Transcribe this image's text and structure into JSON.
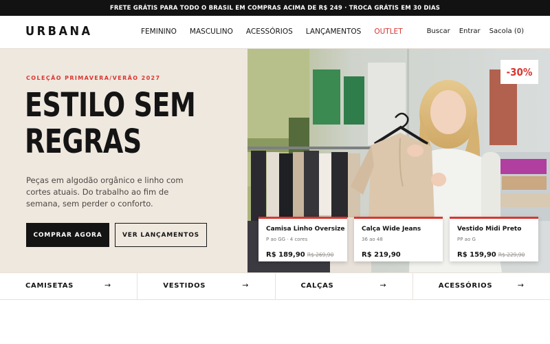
{
  "promo": {
    "text": "FRETE GRÁTIS PARA TODO O BRASIL EM COMPRAS ACIMA DE R$ 249 · TROCA GRÁTIS EM 30 DIAS"
  },
  "header": {
    "logo": "URBANA",
    "nav": [
      "FEMININO",
      "MASCULINO",
      "ACESSÓRIOS",
      "LANÇAMENTOS",
      "OUTLET"
    ],
    "search": "Buscar",
    "login": "Entrar",
    "cart": "Sacola (0)"
  },
  "hero": {
    "eyebrow": "COLEÇÃO PRIMAVERA/VERÃO 2027",
    "title_line1": "ESTILO SEM",
    "title_line2": "REGRAS",
    "copy": "Peças em algodão orgânico e linho com cortes atuais. Do trabalho ao fim de semana, sem perder o conforto.",
    "cta_primary": "COMPRAR AGORA",
    "cta_secondary": "VER LANÇAMENTOS",
    "badge": "-30%"
  },
  "products": [
    {
      "name": "Camisa Linho Oversize",
      "meta": "P ao GG · 4 cores",
      "price": "R$ 189,90",
      "old_price": "R$ 269,90"
    },
    {
      "name": "Calça Wide Jeans",
      "meta": "36 ao 48",
      "price": "R$ 219,90",
      "old_price": ""
    },
    {
      "name": "Vestido Midi Preto",
      "meta": "PP ao G",
      "price": "R$ 159,90",
      "old_price": "R$ 229,90"
    }
  ],
  "categories": [
    {
      "label": "CAMISETAS",
      "arrow": "→"
    },
    {
      "label": "VESTIDOS",
      "arrow": "→"
    },
    {
      "label": "CALÇAS",
      "arrow": "→"
    },
    {
      "label": "ACESSÓRIOS",
      "arrow": "→"
    }
  ],
  "colors": {
    "accent": "#d9352f",
    "dark": "#141414",
    "hero_bg": "#efe8df"
  },
  "image": {
    "hero_photo": "woman-holding-beige-blouse-in-clothing-store"
  }
}
